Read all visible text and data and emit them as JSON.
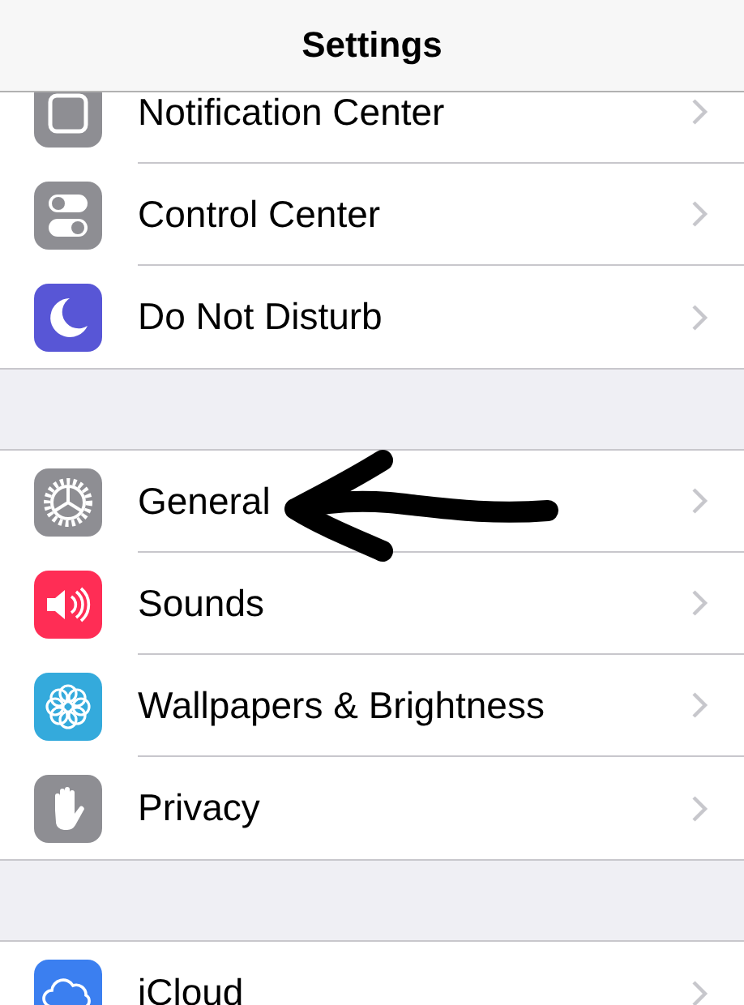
{
  "nav_bar": {
    "title": "Settings"
  },
  "sections": [
    {
      "rows": [
        {
          "label": "Notification Center",
          "color": "#8e8e93"
        },
        {
          "label": "Control Center",
          "color": "#8e8e93"
        },
        {
          "label": "Do Not Disturb",
          "color": "#5856d6"
        }
      ]
    },
    {
      "rows": [
        {
          "label": "General",
          "color": "#8e8e93"
        },
        {
          "label": "Sounds",
          "color": "#ff2d55"
        },
        {
          "label": "Wallpapers & Brightness",
          "color": "#34aadc"
        },
        {
          "label": "Privacy",
          "color": "#8e8e93"
        }
      ]
    },
    {
      "rows": [
        {
          "label": "iCloud",
          "color": "#3b7ff0"
        }
      ]
    }
  ],
  "annotation": {
    "kind": "arrow"
  }
}
